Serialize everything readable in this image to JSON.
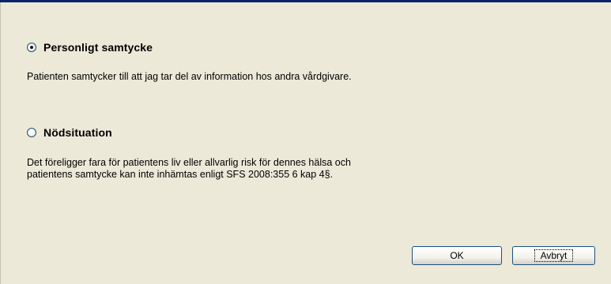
{
  "options": [
    {
      "label": "Personligt samtycke",
      "checked": true,
      "description": "Patienten samtycker till att jag tar del av information hos andra vårdgivare."
    },
    {
      "label": "Nödsituation",
      "checked": false,
      "description": "Det föreligger fara för patientens liv eller allvarlig risk för dennes hälsa och\npatientens samtycke kan inte inhämtas enligt SFS 2008:355 6 kap 4§."
    }
  ],
  "buttons": {
    "ok_label": "OK",
    "cancel_label": "Avbryt"
  },
  "colors": {
    "window_bg": "#ece9d8",
    "title_bar": "#0a246a",
    "button_border": "#1c5180"
  }
}
